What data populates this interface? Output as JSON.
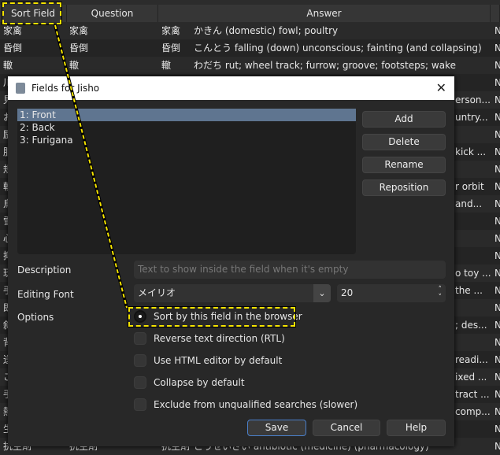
{
  "browser": {
    "columns": [
      "Sort Field",
      "Question",
      "Answer"
    ],
    "rows": [
      {
        "sort": "家禽",
        "question": "家禽",
        "answer_kanji": "家禽",
        "answer": "かきん (domestic) fowl; poultry",
        "right": "",
        "extra": "N"
      },
      {
        "sort": "昏倒",
        "question": "昏倒",
        "answer_kanji": "昏倒",
        "answer": "こんとう falling (down) unconscious; fainting (and collapsing)",
        "right": "",
        "extra": "N"
      },
      {
        "sort": "轍",
        "question": "轍",
        "answer_kanji": "轍",
        "answer": "わだち rut; wheel track; furrow; groove; footsteps; wake",
        "right": "",
        "extra": "N"
      },
      {
        "sort": "川",
        "right": "",
        "extra": "N"
      },
      {
        "sort": "見",
        "right": "erson...",
        "extra": "N"
      },
      {
        "sort": "お",
        "right": "untry...",
        "extra": "N"
      },
      {
        "sort": "励",
        "right": "",
        "extra": "N"
      },
      {
        "sort": "服",
        "right": "kick ...",
        "extra": "N"
      },
      {
        "sort": "規",
        "right": "",
        "extra": "N"
      },
      {
        "sort": "軌",
        "right": "r orbit",
        "extra": "N"
      },
      {
        "sort": "鳥",
        "right": "and...",
        "extra": "N"
      },
      {
        "sort": "雪",
        "right": "",
        "extra": "N"
      },
      {
        "sort": "心",
        "right": "",
        "extra": "N"
      },
      {
        "sort": "抑",
        "right": "",
        "extra": "N"
      },
      {
        "sort": "玩",
        "right": "o toy ...",
        "extra": "N"
      },
      {
        "sort": "手",
        "right": "the ...",
        "extra": "N"
      },
      {
        "sort": "即",
        "right": "",
        "extra": "N"
      },
      {
        "sort": "斜",
        "right": "; des...",
        "extra": "N"
      },
      {
        "sort": "背",
        "right": "",
        "extra": "N"
      },
      {
        "sort": "送",
        "right": "readi...",
        "extra": "N"
      },
      {
        "sort": "こ",
        "right": "ixed ...",
        "extra": "N"
      },
      {
        "sort": "手",
        "right": "tract ...",
        "extra": "N"
      },
      {
        "sort": "熱",
        "right": "comp...",
        "extra": "N"
      },
      {
        "sort": "生",
        "right": "",
        "extra": "N"
      },
      {
        "sort": "抗生剤",
        "question": "抗生剤",
        "answer_kanji": "抗生剤",
        "answer": "こうせいざい antibiotic (medicine) (pharmacology)",
        "right": "",
        "extra": "N"
      }
    ]
  },
  "dialog": {
    "title": "Fields for Jisho",
    "fields": [
      "1: Front",
      "2: Back",
      "3: Furigana"
    ],
    "buttons": {
      "add": "Add",
      "delete": "Delete",
      "rename": "Rename",
      "reposition": "Reposition",
      "save": "Save",
      "cancel": "Cancel",
      "help": "Help"
    },
    "labels": {
      "description": "Description",
      "font": "Editing Font",
      "options": "Options"
    },
    "description_placeholder": "Text to show inside the field when it's empty",
    "font": "メイリオ",
    "font_size": "20",
    "options": [
      "Sort by this field in the browser",
      "Reverse text direction (RTL)",
      "Use HTML editor by default",
      "Collapse by default",
      "Exclude from unqualified searches (slower)"
    ]
  }
}
